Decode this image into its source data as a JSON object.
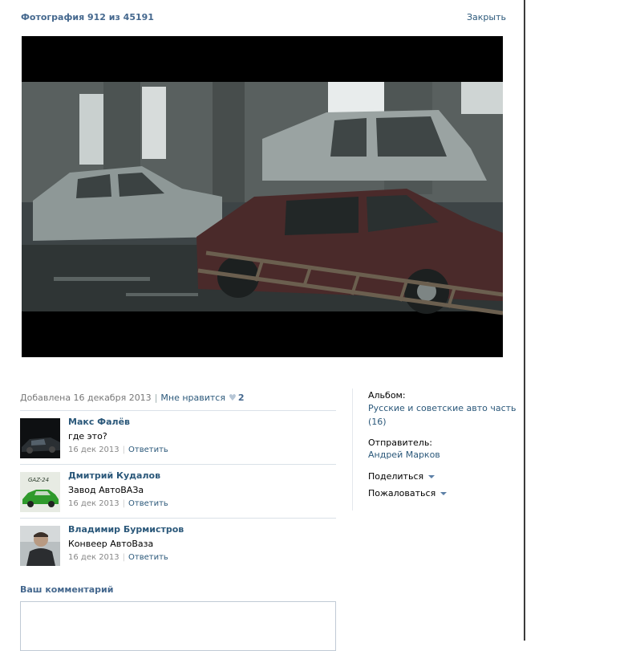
{
  "header": {
    "title": "Фотография 912 из 45191",
    "close_label": "Закрыть"
  },
  "photo": {
    "alt": "Разобранные автомобили в цеху"
  },
  "meta": {
    "added": "Добавлена 16 декабря 2013",
    "like_label": "Мне нравится",
    "like_count": "2"
  },
  "comments": [
    {
      "author": "Макс Фалёв",
      "text": "где это?",
      "date": "16 дек 2013",
      "reply": "Ответить"
    },
    {
      "author": "Дмитрий Кудалов",
      "text": "Завод АвтоВАЗа",
      "date": "16 дек 2013",
      "reply": "Ответить"
    },
    {
      "author": "Владимир Бурмистров",
      "text": "Конвеер АвтоВаза",
      "date": "16 дек 2013",
      "reply": "Ответить"
    }
  ],
  "avatar2_badge": "GAZ-24",
  "comment_form": {
    "title": "Ваш комментарий",
    "value": ""
  },
  "sidebar": {
    "album_label": "Альбом:",
    "album_name": "Русские и советские авто часть",
    "album_count": "(16)",
    "sender_label": "Отправитель:",
    "sender_name": "Андрей Марков",
    "share_label": "Поделиться",
    "report_label": "Пожаловаться"
  },
  "colors": {
    "link": "#2b587a",
    "title": "#45688e",
    "muted": "#777777",
    "divider": "#dae1e8"
  }
}
